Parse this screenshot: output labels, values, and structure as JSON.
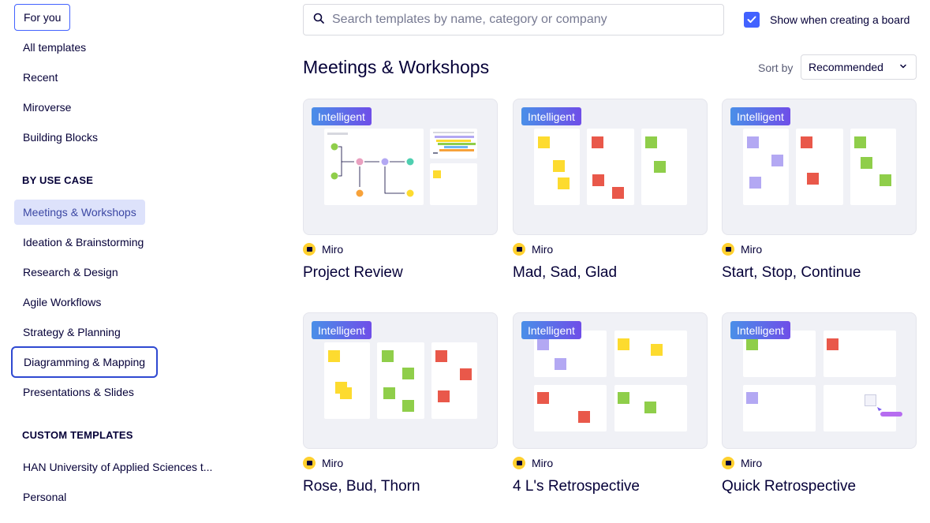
{
  "sidebar": {
    "top_items": [
      "For you",
      "All templates",
      "Recent",
      "Miroverse",
      "Building Blocks"
    ],
    "use_case_heading": "BY USE CASE",
    "use_case_items": [
      "Meetings & Workshops",
      "Ideation & Brainstorming",
      "Research & Design",
      "Agile Workflows",
      "Strategy & Planning",
      "Diagramming & Mapping",
      "Presentations & Slides"
    ],
    "custom_heading": "CUSTOM TEMPLATES",
    "custom_items": [
      "HAN University of Applied Sciences t...",
      "Personal"
    ]
  },
  "search": {
    "placeholder": "Search templates by name, category or company",
    "value": ""
  },
  "show_checkbox": {
    "label": "Show when creating a board",
    "checked": true
  },
  "main": {
    "title": "Meetings & Workshops",
    "sort_label": "Sort by",
    "sort_value": "Recommended"
  },
  "cards": [
    {
      "badge": "Intelligent",
      "author": "Miro",
      "title": "Project Review"
    },
    {
      "badge": "Intelligent",
      "author": "Miro",
      "title": "Mad, Sad, Glad"
    },
    {
      "badge": "Intelligent",
      "author": "Miro",
      "title": "Start, Stop, Continue"
    },
    {
      "badge": "Intelligent",
      "author": "Miro",
      "title": "Rose, Bud, Thorn"
    },
    {
      "badge": "Intelligent",
      "author": "Miro",
      "title": "4 L's Retrospective"
    },
    {
      "badge": "Intelligent",
      "author": "Miro",
      "title": "Quick Retrospective"
    }
  ],
  "colors": {
    "accent": "#4262ff",
    "active_bg": "#dde2fb",
    "badge_start": "#4a8fe8",
    "badge_end": "#6f4ee8"
  }
}
